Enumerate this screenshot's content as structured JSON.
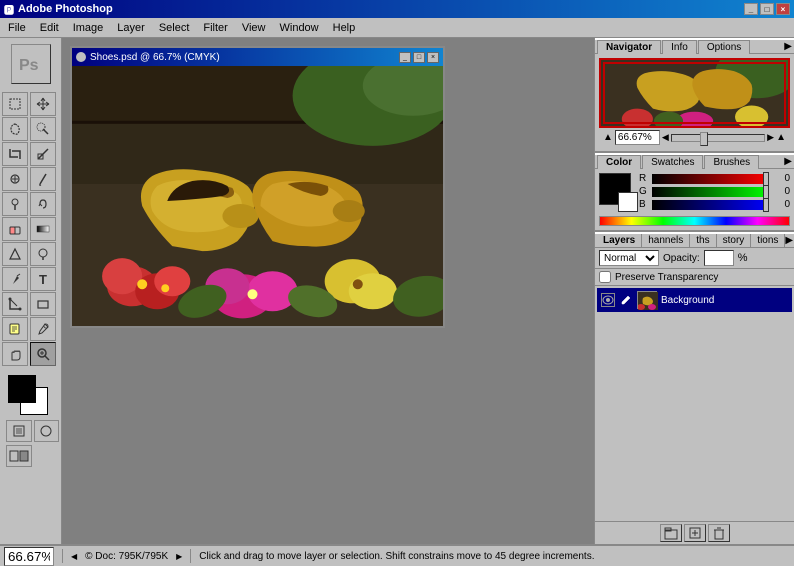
{
  "app": {
    "title": "Adobe Photoshop",
    "logo_icon": "ps"
  },
  "title_bar": {
    "label": "Adobe Photoshop",
    "buttons": [
      "_",
      "□",
      "×"
    ]
  },
  "menu": {
    "items": [
      "File",
      "Edit",
      "Image",
      "Layer",
      "Select",
      "Filter",
      "View",
      "Window",
      "Help"
    ]
  },
  "document": {
    "title": "Shoes.psd @ 66.7% (CMYK)",
    "buttons": [
      "_",
      "□",
      "×"
    ]
  },
  "navigator": {
    "tabs": [
      "Navigator",
      "Info",
      "Options"
    ],
    "zoom_value": "66.67%"
  },
  "color_panel": {
    "tabs": [
      "Color",
      "Swatches",
      "Brushes"
    ],
    "sliders": [
      {
        "label": "R",
        "value": "0"
      },
      {
        "label": "G",
        "value": "0"
      },
      {
        "label": "B",
        "value": "0"
      }
    ]
  },
  "layers_panel": {
    "tabs": [
      "Layers",
      "hannels",
      "ths",
      "story",
      "tions"
    ],
    "blend_mode": "Normal",
    "opacity_label": "Opacity:",
    "opacity_value": "",
    "opacity_percent": "%",
    "preserve_label": "Preserve Transparency",
    "layers": [
      {
        "name": "Background",
        "visible": true,
        "selected": true
      }
    ],
    "bottom_buttons": [
      "⬛",
      "📁",
      "🗑"
    ]
  },
  "status_bar": {
    "zoom": "66.67%",
    "doc_label": "© Doc: 795K/795K",
    "message": "Click and drag to move layer or selection. Shift constrains move to 45 degree increments."
  },
  "toolbar": {
    "tools": [
      {
        "name": "marquee",
        "icon": "⬚"
      },
      {
        "name": "move",
        "icon": "✛"
      },
      {
        "name": "lasso",
        "icon": "⌒"
      },
      {
        "name": "magic-wand",
        "icon": "✦"
      },
      {
        "name": "crop",
        "icon": "⊞"
      },
      {
        "name": "slice",
        "icon": "✂"
      },
      {
        "name": "healing",
        "icon": "⊕"
      },
      {
        "name": "brush",
        "icon": "✏"
      },
      {
        "name": "clone-stamp",
        "icon": "⊛"
      },
      {
        "name": "history-brush",
        "icon": "↺"
      },
      {
        "name": "eraser",
        "icon": "◻"
      },
      {
        "name": "gradient",
        "icon": "▦"
      },
      {
        "name": "blur",
        "icon": "◉"
      },
      {
        "name": "dodge",
        "icon": "○"
      },
      {
        "name": "pen",
        "icon": "✒"
      },
      {
        "name": "type",
        "icon": "T"
      },
      {
        "name": "path-select",
        "icon": "↖"
      },
      {
        "name": "shape",
        "icon": "□"
      },
      {
        "name": "notes",
        "icon": "📝"
      },
      {
        "name": "eyedropper",
        "icon": "💧"
      },
      {
        "name": "hand",
        "icon": "✋"
      },
      {
        "name": "zoom",
        "icon": "🔍"
      }
    ]
  }
}
